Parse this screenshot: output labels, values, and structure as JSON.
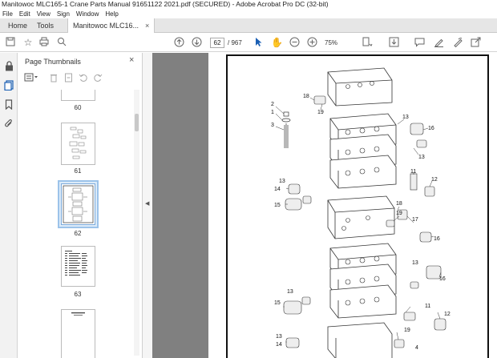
{
  "window": {
    "title": "Manitowoc MLC165-1 Crane Parts Manual 91651122 2021.pdf (SECURED) - Adobe Acrobat Pro DC (32-bit)"
  },
  "menu": [
    "File",
    "Edit",
    "View",
    "Sign",
    "Window",
    "Help"
  ],
  "tabs": {
    "home": "Home",
    "tools": "Tools",
    "document": "Manitowoc MLC16...",
    "close": "×"
  },
  "toolbar": {
    "current_page": "62",
    "total_pages": "/ 967",
    "zoom": "75%"
  },
  "panel": {
    "title": "Page Thumbnails",
    "close": "×",
    "thumbnails": [
      {
        "label": "60"
      },
      {
        "label": "61"
      },
      {
        "label": "62",
        "selected": true
      },
      {
        "label": "63"
      },
      {
        "label": ""
      }
    ]
  },
  "diagram": {
    "callouts": [
      "1",
      "2",
      "3",
      "4",
      "11",
      "12",
      "13",
      "14",
      "15",
      "16",
      "17",
      "18",
      "19"
    ]
  },
  "colors": {
    "viewer_bg": "#808080",
    "selection": "#dcebf9",
    "tabbar_bg": "#e6e6e6"
  }
}
